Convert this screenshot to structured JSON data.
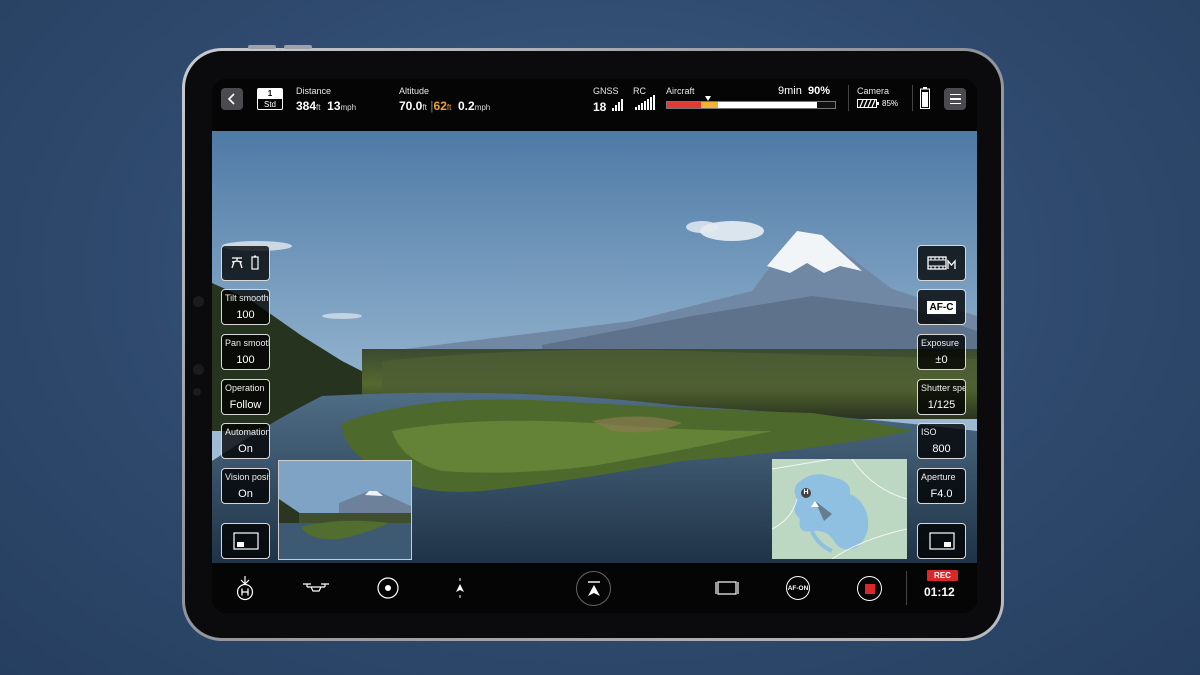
{
  "topbar": {
    "mode": {
      "number": "1",
      "label": "Std"
    },
    "distance": {
      "label": "Distance",
      "value": "384",
      "unit": "ft",
      "speed": "13",
      "speed_unit": "mph"
    },
    "altitude": {
      "label": "Altitude",
      "value": "70.0",
      "unit": "ft",
      "secondary": "62",
      "secondary_unit": "ft",
      "speed": "0.2",
      "speed_unit": "mph"
    },
    "gnss": {
      "label": "GNSS",
      "value": "18"
    },
    "rc": {
      "label": "RC"
    },
    "aircraft": {
      "label": "Aircraft",
      "time": "9min",
      "percent": "90%",
      "battery_level": 0.9
    },
    "camera": {
      "label": "Camera",
      "percent": "85%"
    }
  },
  "left_controls": [
    {
      "id": "tilt",
      "label": "Tilt smoothing",
      "value": "100"
    },
    {
      "id": "pan",
      "label": "Pan smoothing",
      "value": "100"
    },
    {
      "id": "operation",
      "label": "Operation",
      "value": "Follow"
    },
    {
      "id": "automation",
      "label": "Automation",
      "value": "On"
    },
    {
      "id": "vision",
      "label": "Vision position",
      "value": "On"
    }
  ],
  "right_controls": {
    "focus_mode": "AF-C",
    "items": [
      {
        "id": "exposure",
        "label": "Exposure",
        "value": "±0"
      },
      {
        "id": "shutter",
        "label": "Shutter speed",
        "value": "1/125"
      },
      {
        "id": "iso",
        "label": "ISO",
        "value": "800"
      },
      {
        "id": "aperture",
        "label": "Aperture",
        "value": "F4.0"
      }
    ]
  },
  "bottombar": {
    "af_on_label": "AF-ON",
    "rec_label": "REC",
    "rec_time": "01:12"
  },
  "minimap": {
    "home_label": "H"
  },
  "icons": {
    "back": "chevron-left-icon",
    "menu": "hamburger-menu-icon",
    "drone_battery": "drone-battery-icon",
    "movie_mode": "movie-mode-icon",
    "return_home": "return-to-home-icon",
    "drone": "drone-icon",
    "gimbal": "gimbal-target-icon",
    "compass": "compass-arrow-icon",
    "takeoff": "takeoff-icon",
    "aspect": "aspect-frame-icon",
    "record": "record-stop-icon"
  },
  "colors": {
    "record": "#d8282a",
    "battery_red": "#e23b34",
    "battery_yellow": "#f2b233",
    "altitude_accent": "#f1a230"
  }
}
